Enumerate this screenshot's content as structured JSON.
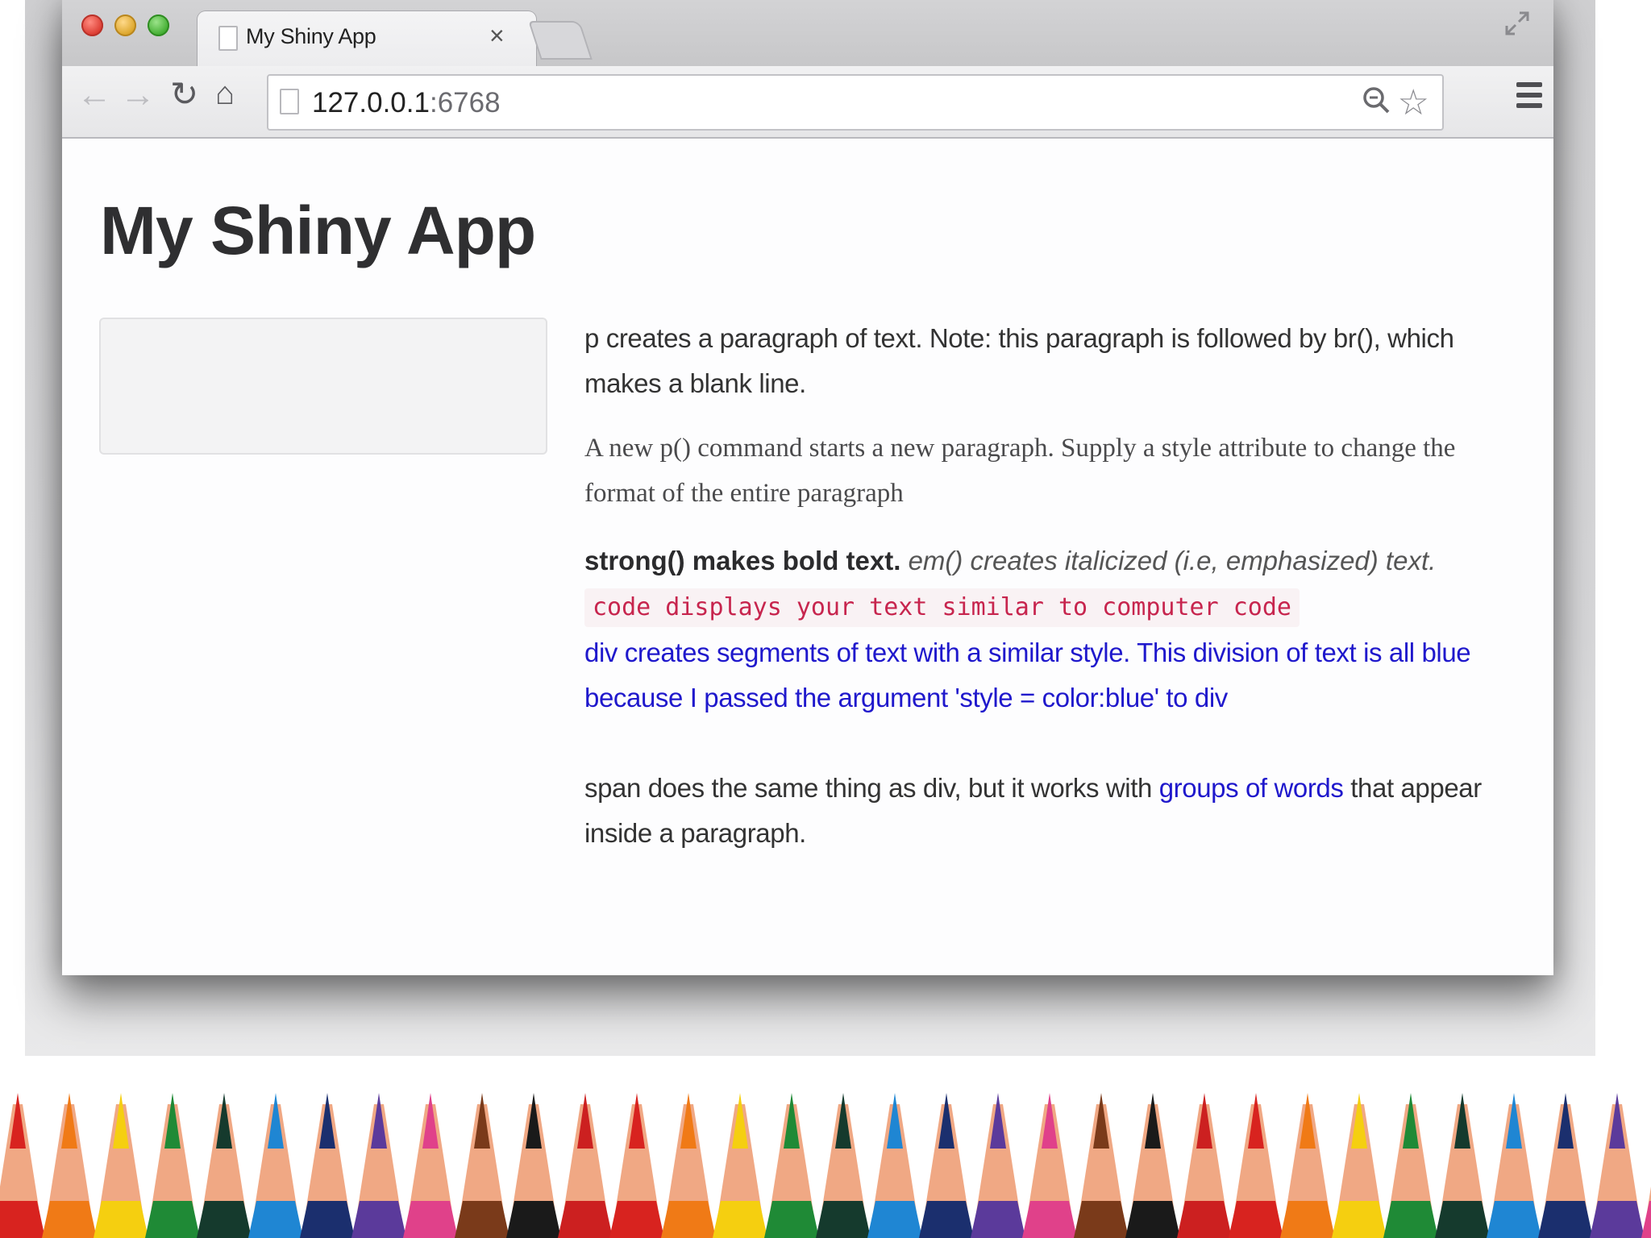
{
  "browser": {
    "tab_title": "My Shiny App",
    "tab_close": "×",
    "url_host": "127.0.0.1",
    "url_port": ":6768",
    "icons": {
      "back": "back-arrow-icon",
      "forward": "forward-arrow-icon",
      "reload": "reload-icon",
      "home": "home-icon",
      "zoom": "zoom-icon",
      "star": "bookmark-star-icon",
      "menu": "hamburger-menu-icon",
      "fullscreen": "fullscreen-icon"
    }
  },
  "app": {
    "title": "My Shiny App",
    "p1": "p creates a paragraph of text. Note: this paragraph is followed by br(), which makes a blank line.",
    "p2": "A new p() command starts a new paragraph. Supply a style attribute to change the format of the entire paragraph",
    "strong_text": "strong() makes bold text.",
    "em_text": "em() creates italicized (i.e, emphasized) text.",
    "code_text": "code displays your text similar to computer code",
    "div_text": "div creates segments of text with a similar style. This division of text is all blue because I passed the argument 'style = color:blue' to div",
    "span_before": "span does the same thing as div, but it works with ",
    "span_blue": "groups of words",
    "span_after": " that appear inside a paragraph."
  },
  "colors": {
    "blue_text": "#1f18cc",
    "code_text": "#c7254e",
    "code_bg": "#f9f2f4",
    "title_text": "#2f2f31"
  }
}
